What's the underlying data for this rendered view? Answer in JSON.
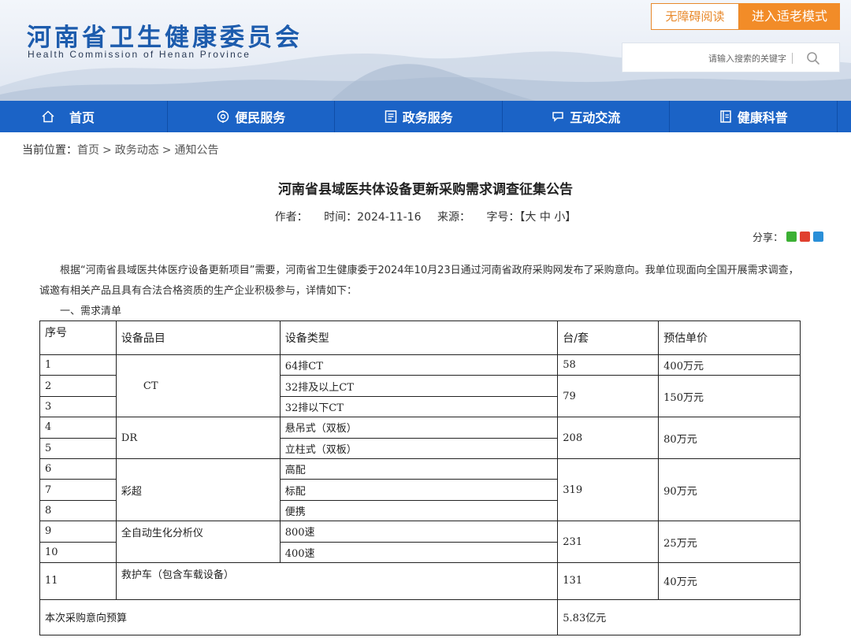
{
  "header": {
    "site_name": "河南省卫生健康委员会",
    "site_name_en": "Health Commission of Henan Province",
    "accessibility_button": "无障碍阅读",
    "elder_mode_button": "进入适老模式",
    "search": {
      "placeholder": "请输入搜索的关键字",
      "value": ""
    }
  },
  "nav": {
    "items": [
      {
        "label": "首页",
        "icon": "home-icon"
      },
      {
        "label": "便民服务",
        "icon": "service-icon"
      },
      {
        "label": "政务服务",
        "icon": "government-icon"
      },
      {
        "label": "互动交流",
        "icon": "interaction-icon"
      },
      {
        "label": "健康科普",
        "icon": "health-science-icon"
      }
    ]
  },
  "breadcrumb": {
    "prefix": "当前位置：",
    "items": [
      "首页",
      "政务动态",
      "通知公告"
    ],
    "separator": ">"
  },
  "article": {
    "title": "河南省县域医共体设备更新采购需求调查征集公告",
    "meta": {
      "author_label": "作者：",
      "author": "",
      "time_label": "时间：",
      "time": "2024-11-16",
      "source_label": "来源：",
      "source": "",
      "fontsize_label": "字号：",
      "fontsize_options": [
        "【大",
        "中",
        "小】"
      ]
    },
    "share_label": "分享：",
    "share_icons": [
      "wechat-icon",
      "weibo-icon",
      "qq-icon"
    ],
    "intro": "根据“河南省县域医共体医疗设备更新项目”需要，河南省卫生健康委于2024年10月23日通过河南省政府采购网发布了采购意向。我单位现面向全国开展需求调查，诚邀有相关产品且具有合法合格资质的生产企业积极参与，详情如下：",
    "section_heading": "一、需求清单",
    "table": {
      "headers": [
        "序号",
        "设备品目",
        "设备类型",
        "台/套",
        "预估单价"
      ],
      "rows": [
        [
          "1",
          "CT",
          "64排CT",
          "58",
          "400万元"
        ],
        [
          "2",
          "",
          "32排及以上CT",
          "79",
          "150万元"
        ],
        [
          "3",
          "",
          "32排以下CT",
          "",
          ""
        ],
        [
          "4",
          "DR",
          "悬吊式（双板）",
          "208",
          "80万元"
        ],
        [
          "5",
          "",
          "立柱式（双板）",
          "",
          ""
        ],
        [
          "6",
          "彩超",
          "高配",
          "319",
          "90万元"
        ],
        [
          "7",
          "",
          "标配",
          "",
          ""
        ],
        [
          "8",
          "",
          "便携",
          "",
          ""
        ],
        [
          "9",
          "全自动生化分析仪",
          "800速",
          "231",
          "25万元"
        ],
        [
          "10",
          "",
          "400速",
          "",
          ""
        ],
        [
          "11",
          "救护车（包含车载设备）",
          "",
          "131",
          "40万元"
        ]
      ],
      "total_label": "本次采购意向预算",
      "total_value": "5.83亿元"
    }
  },
  "colors": {
    "brand_blue": "#1b63c6",
    "logo_blue": "#1d5cad",
    "accent_orange": "#f28c28"
  }
}
